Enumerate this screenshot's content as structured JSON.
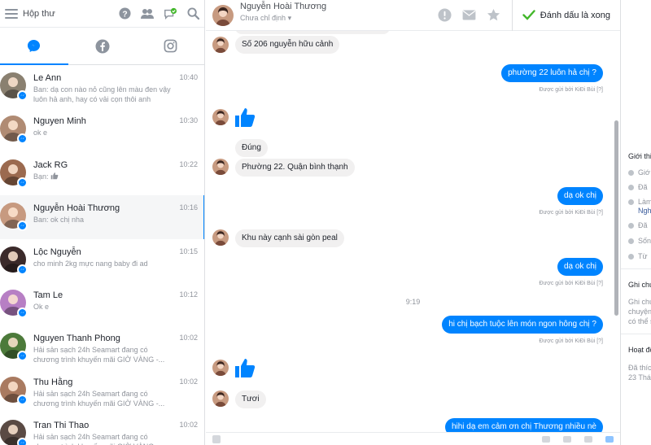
{
  "left": {
    "title": "Hộp thư",
    "conversations": [
      {
        "name": "Le Ann",
        "time": "10:40",
        "snippet1": "Ban: dạ con nào nỏ cũng lên màu đen vậy",
        "snippet2": "luôn hả anh, hay có vải cọn thôi anh",
        "avatar_color": "#8a8070"
      },
      {
        "name": "Nguyen Minh",
        "time": "10:30",
        "snippet1": "ok e",
        "snippet2": "",
        "avatar_color": "#b08b73"
      },
      {
        "name": "Jack RG",
        "time": "10:22",
        "snippet1": "Bạn:",
        "snippet2": "",
        "avatar_color": "#9b6a4f",
        "snippet_like": true
      },
      {
        "name": "Nguyễn Hoài Thương",
        "time": "10:16",
        "snippet1": "Ban: ok chị nha",
        "snippet2": "",
        "avatar_color": "#c79a80"
      },
      {
        "name": "Lộc Nguyễn",
        "time": "10:15",
        "snippet1": "cho minh 2kg mực nang baby đi ad",
        "snippet2": "",
        "avatar_color": "#3b2a2a"
      },
      {
        "name": "Tam Le",
        "time": "10:12",
        "snippet1": "Ok e",
        "snippet2": "",
        "avatar_color": "#b77fc4"
      },
      {
        "name": "Nguyen Thanh Phong",
        "time": "10:02",
        "snippet1": "Hải sản sạch 24h Seamart đang có",
        "snippet2": "chương trình khuyến mãi GIỜ VÀNG -...",
        "avatar_color": "#4c7a3a"
      },
      {
        "name": "Thu Hằng",
        "time": "10:02",
        "snippet1": "Hải sản sạch 24h Seamart đang có",
        "snippet2": "chương trình khuyến mãi GIỜ VÀNG -...",
        "avatar_color": "#a97a60"
      },
      {
        "name": "Tran Thi Thao",
        "time": "10:02",
        "snippet1": "Hải sản sạch 24h Seamart đang có",
        "snippet2": "chương trình khuyến mãi GIỜ VÀNG -...",
        "avatar_color": "#5a4a44"
      }
    ]
  },
  "header": {
    "contact_name": "Nguyễn Hoài Thương",
    "status": "Chưa chỉ định",
    "done_label": "Đánh dấu là xong"
  },
  "thread": {
    "msg1": "Số 206 nguyễn hữu cảnh",
    "msg2": "phường 22 luôn  hả chị ?",
    "sent_by": "Được gửi bởi KiĐi Bùi",
    "sent_by_mark": "[?]",
    "msg3": "Đúng",
    "msg4": "Phường 22. Quận bình thạnh",
    "msg5": "dạ ok chị",
    "msg6": "Khu này cạnh sài gòn peal",
    "msg7": "dạ ok chị",
    "timestamp": "9:19",
    "msg8": "hi chị  bạch tuộc lên món ngon hông chị ?",
    "msg9": "Tươi",
    "msg10": "hihi dạ em cảm ơn chị Thương nhiều nè"
  },
  "right": {
    "intro_title": "Giới thi",
    "items": [
      "Giớ",
      "Đã",
      "Làm",
      "Đã",
      "Sốn",
      "Từ"
    ],
    "link": "Nghề",
    "notes_title": "Ghi chú",
    "notes_text1": "Ghi chú",
    "notes_text2": "chuyện",
    "notes_text3": "có thể s",
    "activity_title": "Hoạt độ",
    "activity_text1": "Đã thíc",
    "activity_text2": "23 Thá"
  },
  "colors": {
    "accent": "#0084ff",
    "done_green": "#42b72a",
    "bubble_in": "#f1f0f0"
  }
}
